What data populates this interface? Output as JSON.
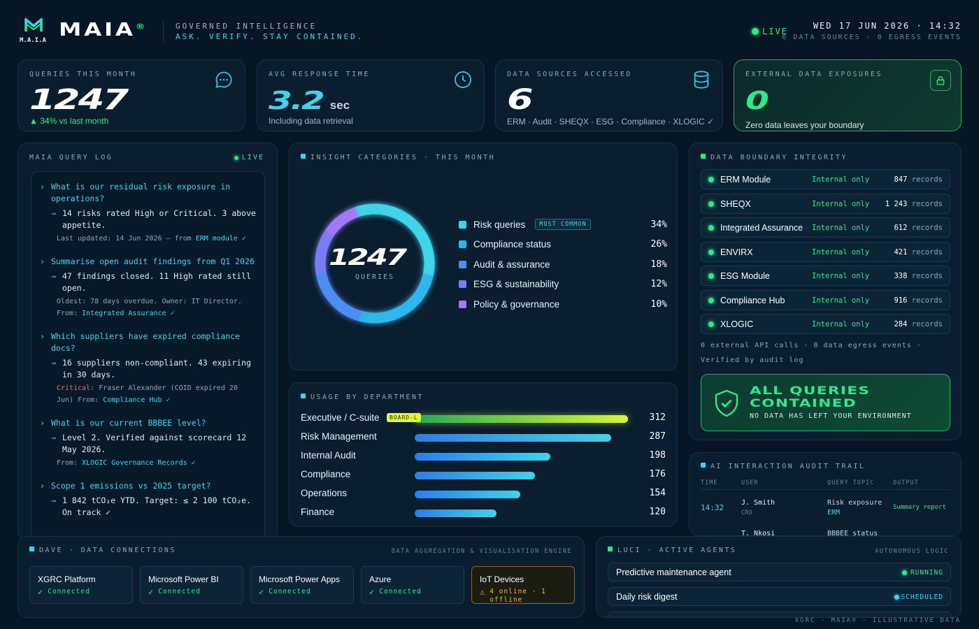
{
  "brand": {
    "logo_mark": "M.A.I.A",
    "name": "MAIA",
    "reg": "®",
    "tag1": "GOVERNED INTELLIGENCE",
    "tag2": "ASK. VERIFY. STAY CONTAINED."
  },
  "status": {
    "live": "LIVE",
    "datetime": "WED 17 JUN 2026 · 14:32",
    "sub": "6 DATA SOURCES · 0 EGRESS EVENTS"
  },
  "kpis": [
    {
      "label": "QUERIES THIS MONTH",
      "value": "1247",
      "unit": "",
      "note": "▲ 34% vs last month",
      "icon": "chat-icon"
    },
    {
      "label": "AVG RESPONSE TIME",
      "value": "3.2",
      "unit": "sec",
      "note": "Including data retrieval",
      "icon": "clock-icon"
    },
    {
      "label": "DATA SOURCES ACCESSED",
      "value": "6",
      "unit": "",
      "note": "ERM · Audit · SHEQX · ESG · Compliance · XLOGIC ✓ all internal",
      "icon": "database-icon"
    },
    {
      "label": "EXTERNAL DATA EXPOSURES",
      "value": "0",
      "unit": "",
      "note": "Zero data leaves your boundary",
      "icon": "lock-icon"
    }
  ],
  "query_log": {
    "title": "MAIA QUERY LOG",
    "live": "LIVE",
    "items": [
      {
        "q": "What is our residual risk exposure in operations?",
        "a": "14 risks rated High or Critical. 3 above appetite.",
        "meta": "Last updated: 14 Jun 2026 — from",
        "src": "ERM module ✓",
        "critical": ""
      },
      {
        "q": "Summarise open audit findings from Q1 2026",
        "a": "47 findings closed. 11 High rated still open.",
        "meta": "Oldest: 78 days overdue. Owner: IT Director. From:",
        "src": "Integrated Assurance ✓",
        "critical": ""
      },
      {
        "q": "Which suppliers have expired compliance docs?",
        "a": "16 suppliers non-compliant. 43 expiring in 30 days.",
        "critical": "Critical:",
        "meta": "Fraser Alexander (COID expired 20 Jun) From:",
        "src": "Compliance Hub ✓"
      },
      {
        "q": "What is our current BBBEE level?",
        "a": "Level 2. Verified against scorecard 12 May 2026.",
        "meta": "From:",
        "src": "XLOGIC Governance Records ✓",
        "critical": ""
      },
      {
        "q": "Scope 1 emissions vs 2025 target?",
        "a": "1 842 tCO₂e YTD. Target: ≤ 2 100 tCO₂e. On track ✓",
        "meta": "",
        "src": "",
        "critical": ""
      }
    ]
  },
  "insights": {
    "title": "INSIGHT CATEGORIES · THIS MONTH",
    "center_value": "1247",
    "center_label": "QUERIES",
    "badge": "MOST COMMON",
    "items": [
      {
        "name": "Risk queries",
        "pct": "34%",
        "value": 34,
        "color": "#3fd4e8"
      },
      {
        "name": "Compliance status",
        "pct": "26%",
        "value": 26,
        "color": "#2fb6ec"
      },
      {
        "name": "Audit & assurance",
        "pct": "18%",
        "value": 18,
        "color": "#4d8cf0"
      },
      {
        "name": "ESG & sustainability",
        "pct": "12%",
        "value": 12,
        "color": "#7a7cf2"
      },
      {
        "name": "Policy & governance",
        "pct": "10%",
        "value": 10,
        "color": "#a179f4"
      }
    ]
  },
  "usage": {
    "title": "USAGE BY DEPARTMENT",
    "badge": "BOARD-L",
    "max": 312,
    "rows": [
      {
        "name": "Executive / C-suite",
        "value": 312
      },
      {
        "name": "Risk Management",
        "value": 287
      },
      {
        "name": "Internal Audit",
        "value": 198
      },
      {
        "name": "Compliance",
        "value": 176
      },
      {
        "name": "Operations",
        "value": 154
      },
      {
        "name": "Finance",
        "value": 120
      }
    ]
  },
  "boundary": {
    "title": "DATA BOUNDARY INTEGRITY",
    "rows": [
      {
        "name": "ERM Module",
        "scope": "Internal only",
        "count": "847",
        "unit": "records"
      },
      {
        "name": "SHEQX",
        "scope": "Internal only",
        "count": "1 243",
        "unit": "records"
      },
      {
        "name": "Integrated Assurance",
        "scope": "Internal only",
        "count": "612",
        "unit": "records"
      },
      {
        "name": "ENVIRX",
        "scope": "Internal only",
        "count": "421",
        "unit": "records"
      },
      {
        "name": "ESG Module",
        "scope": "Internal only",
        "count": "338",
        "unit": "records"
      },
      {
        "name": "Compliance Hub",
        "scope": "Internal only",
        "count": "916",
        "unit": "records"
      },
      {
        "name": "XLOGIC",
        "scope": "Internal only",
        "count": "284",
        "unit": "records"
      }
    ],
    "footer1": "0 external API calls · 0 data egress events ·",
    "footer2": "Verified by audit log",
    "contained1": "ALL QUERIES",
    "contained2": "CONTAINED",
    "contained_sub": "NO DATA HAS LEFT YOUR ENVIRONMENT"
  },
  "audit": {
    "title": "AI INTERACTION AUDIT TRAIL",
    "cols": [
      "TIME",
      "USER",
      "QUERY TOPIC",
      "OUTPUT"
    ],
    "rows": [
      {
        "time": "14:32",
        "user": "J. Smith",
        "role": "CRO",
        "topic": "Risk exposure",
        "topic2": "ERM",
        "output": "Summary report"
      },
      {
        "time": "",
        "user": "T. Nkosi",
        "role": "",
        "topic": "BBBEE status",
        "topic2": "",
        "output": ""
      }
    ]
  },
  "dave": {
    "title": "DAVE · DATA CONNECTIONS",
    "right": "DATA AGGREGATION & VISUALISATION ENGINE",
    "items": [
      {
        "name": "XGRC Platform",
        "status": "Connected",
        "warn": false
      },
      {
        "name": "Microsoft Power BI",
        "status": "Connected",
        "warn": false
      },
      {
        "name": "Microsoft Power Apps",
        "status": "Connected",
        "warn": false
      },
      {
        "name": "Azure",
        "status": "Connected",
        "warn": false
      },
      {
        "name": "IoT Devices",
        "status": "4 online · 1 offline",
        "warn": true
      }
    ]
  },
  "luci": {
    "title": "LUCI · ACTIVE AGENTS",
    "right": "AUTONOMOUS LOGIC",
    "items": [
      {
        "name": "Predictive maintenance agent",
        "status": "RUNNING",
        "color": "#2ee88a"
      },
      {
        "name": "Daily risk digest",
        "status": "SCHEDULED",
        "color": "#3fd4e8"
      }
    ]
  },
  "footer": "XGRC · MAIA® · ILLUSTRATIVE DATA"
}
